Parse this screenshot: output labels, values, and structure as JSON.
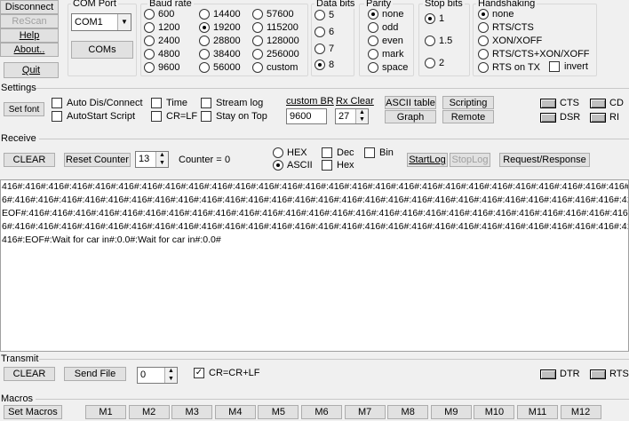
{
  "top_buttons": {
    "disconnect": "Disconnect",
    "rescan": "ReScan",
    "help": "Help",
    "about": "About..",
    "quit": "Quit"
  },
  "com_port": {
    "label": "COM Port",
    "selected": "COM1",
    "coms_button": "COMs"
  },
  "baud_rate": {
    "label": "Baud rate",
    "options": [
      "600",
      "1200",
      "2400",
      "4800",
      "9600",
      "14400",
      "19200",
      "28800",
      "38400",
      "56000",
      "57600",
      "115200",
      "128000",
      "256000",
      "custom"
    ],
    "selected": "19200"
  },
  "data_bits": {
    "label": "Data bits",
    "options": [
      "5",
      "6",
      "7",
      "8"
    ],
    "selected": "8"
  },
  "parity": {
    "label": "Parity",
    "options": [
      "none",
      "odd",
      "even",
      "mark",
      "space"
    ],
    "selected": "none"
  },
  "stop_bits": {
    "label": "Stop bits",
    "options": [
      "1",
      "1.5",
      "2"
    ],
    "selected": "1"
  },
  "handshaking": {
    "label": "Handshaking",
    "options": [
      "none",
      "RTS/CTS",
      "XON/XOFF",
      "RTS/CTS+XON/XOFF",
      "RTS on TX"
    ],
    "selected": "none",
    "invert_label": "invert"
  },
  "settings": {
    "label": "Settings",
    "set_font": "Set font",
    "auto_dis_connect": "Auto Dis/Connect",
    "autostart_script": "AutoStart Script",
    "time": "Time",
    "cr_lf": "CR=LF",
    "stream_log": "Stream log",
    "stay_on_top": "Stay on Top",
    "custom_br_label": "custom BR",
    "custom_br_value": "9600",
    "rx_clear_label": "Rx Clear",
    "rx_clear_value": "27",
    "ascii_table": "ASCII table",
    "scripting": "Scripting",
    "graph": "Graph",
    "remote": "Remote",
    "cts": "CTS",
    "cd": "CD",
    "dsr": "DSR",
    "ri": "RI"
  },
  "receive": {
    "label": "Receive",
    "clear": "CLEAR",
    "reset_counter": "Reset Counter",
    "counter_spin": "13",
    "counter_label": "Counter =",
    "counter_value": "0",
    "hex": "HEX",
    "ascii": "ASCII",
    "dec": "Dec",
    "hex_check": "Hex",
    "bin": "Bin",
    "start_log": "StartLog",
    "stop_log": "StopLog",
    "request_response": "Request/Response"
  },
  "terminal_lines": [
    "416#:416#:416#:416#:416#:416#:416#:416#:416#:416#:416#:416#:416#:416#:416#:416#:416#:416#:416#:416#:416#:416#:416#:416#:416#:416#:416#:416#:41",
    "6#:416#:416#:416#:416#:416#:416#:416#:416#:416#:416#:416#:416#:416#:416#:416#:416#:416#:416#:416#:416#:416#:416#:416#:416#:416#:416#:416#:416#:",
    "EOF#:416#:416#:416#:416#:416#:416#:416#:416#:416#:416#:416#:416#:416#:416#:416#:416#:416#:416#:416#:416#:416#:416#:416#:416#:416#:416#:416#:41",
    "6#:416#:416#:416#:416#:416#:416#:416#:416#:416#:416#:416#:416#:416#:416#:416#:416#:416#:416#:416#:416#:416#:416#:416#:416#:416#:416#:416#:416#:",
    "416#:EOF#:Wait for car in#:0.0#:Wait for car in#:0.0#"
  ],
  "transmit": {
    "label": "Transmit",
    "clear": "CLEAR",
    "send_file": "Send File",
    "spin_value": "0",
    "cr_crlf": "CR=CR+LF",
    "dtr": "DTR",
    "rts": "RTS"
  },
  "macros": {
    "label": "Macros",
    "set_macros": "Set Macros",
    "buttons": [
      "M1",
      "M2",
      "M3",
      "M4",
      "M5",
      "M6",
      "M7",
      "M8",
      "M9",
      "M10",
      "M11",
      "M12"
    ]
  }
}
